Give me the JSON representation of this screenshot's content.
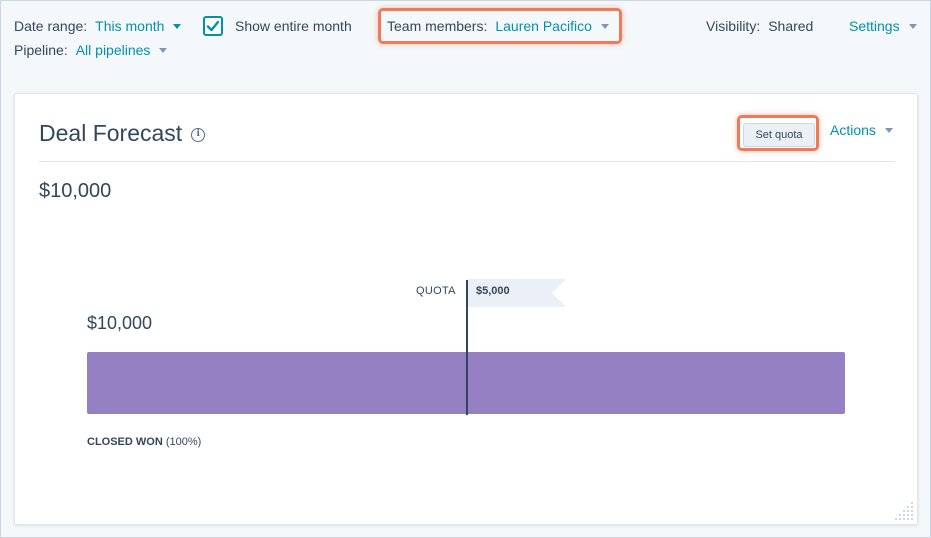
{
  "filters": {
    "date_range": {
      "label": "Date range:",
      "value": "This month"
    },
    "show_entire_month": {
      "label": "Show entire month",
      "checked": true
    },
    "team_members": {
      "label": "Team members:",
      "value": "Lauren Pacifico"
    },
    "visibility": {
      "label": "Visibility:",
      "value": "Shared"
    },
    "settings": {
      "label": "Settings"
    },
    "pipeline": {
      "label": "Pipeline:",
      "value": "All pipelines"
    }
  },
  "card": {
    "title": "Deal Forecast",
    "info_icon": "info-icon",
    "set_quota_label": "Set quota",
    "actions_label": "Actions",
    "total": "$10,000"
  },
  "chart_data": {
    "type": "bar",
    "orientation": "horizontal",
    "categories": [
      "CLOSED WON"
    ],
    "values": [
      10000
    ],
    "value_labels": [
      "$10,000"
    ],
    "max": 10000,
    "stage": {
      "name": "CLOSED WON",
      "percent": "(100%)"
    },
    "quota": {
      "label": "QUOTA",
      "value": 5000,
      "display": "$5,000"
    }
  },
  "colors": {
    "accent": "#0091ae",
    "text": "#33475b",
    "bar": "#9680c4",
    "highlight": "#ec7a5b"
  }
}
